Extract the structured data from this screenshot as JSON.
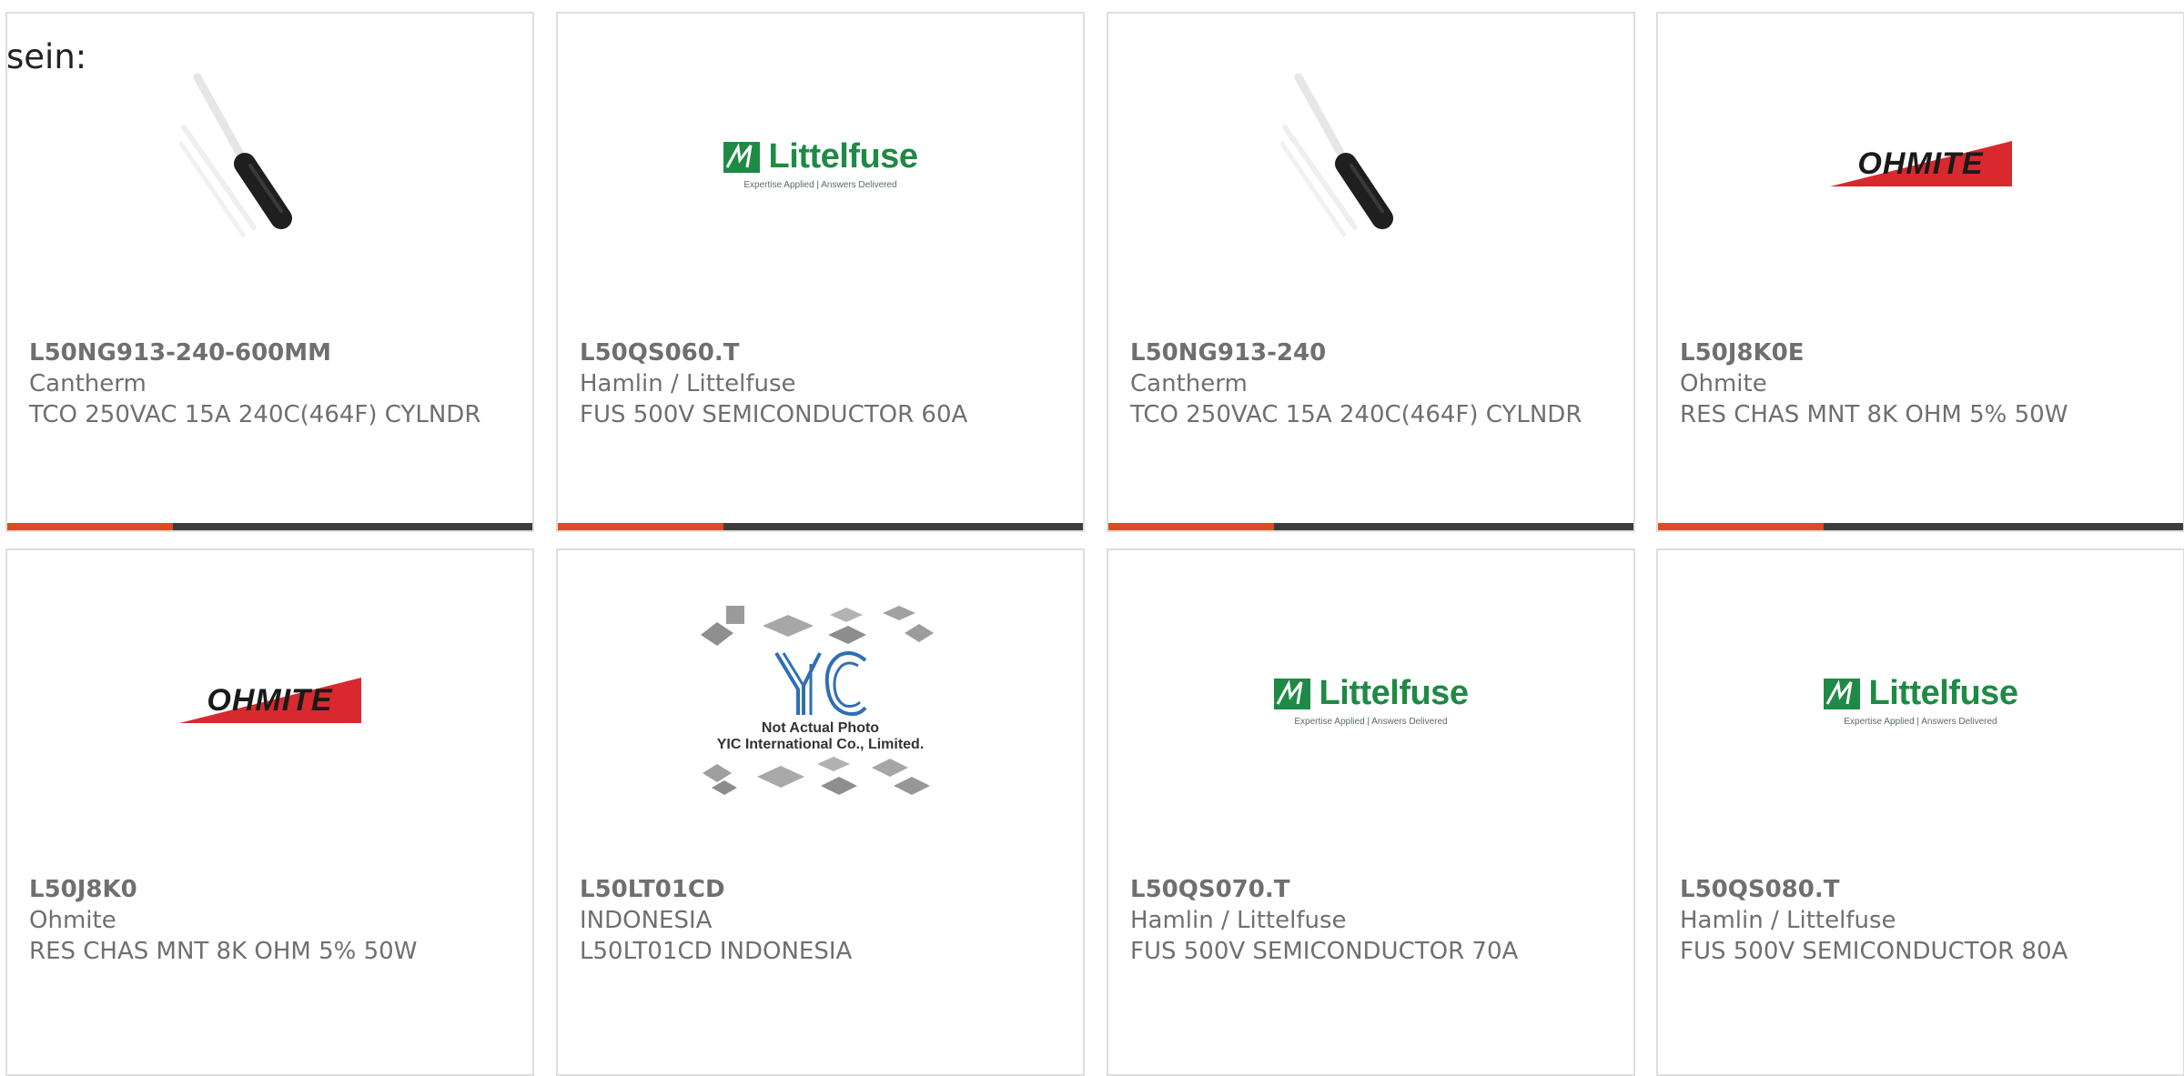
{
  "page": {
    "prefix_text": "sein:"
  },
  "colors": {
    "accent": "#e04a1e",
    "bar": "#3c3c3c",
    "littelfuse_green": "#1f8a45",
    "ohmite_red": "#d8292f"
  },
  "products": [
    {
      "part_number": "L50NG913-240-600MM",
      "manufacturer": "Cantherm",
      "description": "TCO 250VAC 15A 240C(464F) CYLNDR",
      "image": "thermal-cutoff-photo"
    },
    {
      "part_number": "L50QS060.T",
      "manufacturer": "Hamlin / Littelfuse",
      "description": "FUS 500V SEMICONDUCTOR 60A",
      "image": "littelfuse-logo"
    },
    {
      "part_number": "L50NG913-240",
      "manufacturer": "Cantherm",
      "description": "TCO 250VAC 15A 240C(464F) CYLNDR",
      "image": "thermal-cutoff-photo"
    },
    {
      "part_number": "L50J8K0E",
      "manufacturer": "Ohmite",
      "description": "RES CHAS MNT 8K OHM 5% 50W",
      "image": "ohmite-logo"
    },
    {
      "part_number": "L50J8K0",
      "manufacturer": "Ohmite",
      "description": "RES CHAS MNT 8K OHM 5% 50W",
      "image": "ohmite-logo"
    },
    {
      "part_number": "L50LT01CD",
      "manufacturer": "INDONESIA",
      "description": "L50LT01CD INDONESIA",
      "image": "yic-placeholder"
    },
    {
      "part_number": "L50QS070.T",
      "manufacturer": "Hamlin / Littelfuse",
      "description": "FUS 500V SEMICONDUCTOR 70A",
      "image": "littelfuse-logo"
    },
    {
      "part_number": "L50QS080.T",
      "manufacturer": "Hamlin / Littelfuse",
      "description": "FUS 500V SEMICONDUCTOR 80A",
      "image": "littelfuse-logo"
    }
  ],
  "logos": {
    "littelfuse": {
      "name": "Littelfuse",
      "tagline": "Expertise Applied | Answers Delivered"
    },
    "ohmite": {
      "name": "OHMITE"
    },
    "yic": {
      "mark": "YIC",
      "caption_line1": "Not Actual Photo",
      "caption_line2": "YIC International Co., Limited."
    }
  }
}
